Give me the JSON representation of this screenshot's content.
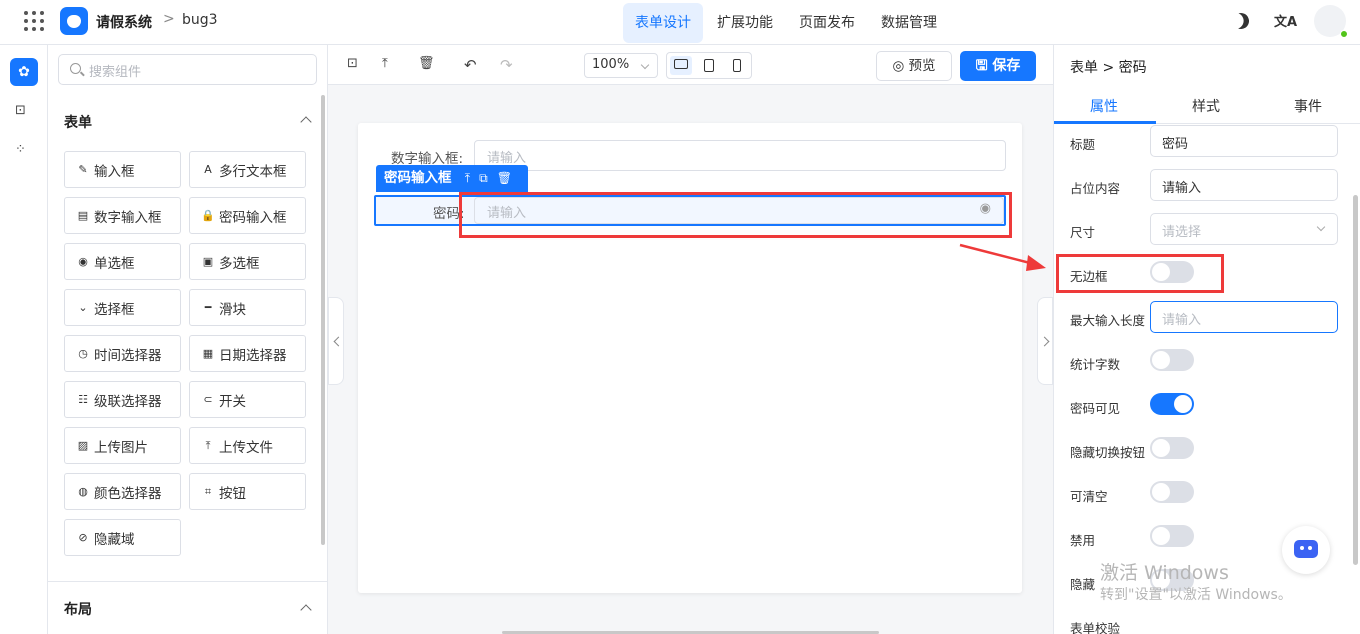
{
  "header": {
    "app_name": "请假系统",
    "separator": ">",
    "project": "bug3",
    "nav": [
      "表单设计",
      "扩展功能",
      "页面发布",
      "数据管理"
    ],
    "active_nav": "表单设计",
    "lang_glyph": "文A"
  },
  "rail": {
    "icons": [
      "puzzle-icon",
      "code-icon",
      "tree-icon"
    ]
  },
  "left": {
    "search_placeholder": "搜索组件",
    "form_section": "表单",
    "components": [
      {
        "label": "输入框",
        "icon": "✎"
      },
      {
        "label": "多行文本框",
        "icon": "A"
      },
      {
        "label": "数字输入框",
        "icon": "▤"
      },
      {
        "label": "密码输入框",
        "icon": "🔒"
      },
      {
        "label": "单选框",
        "icon": "◉"
      },
      {
        "label": "多选框",
        "icon": "▣"
      },
      {
        "label": "选择框",
        "icon": "⌄"
      },
      {
        "label": "滑块",
        "icon": "━"
      },
      {
        "label": "时间选择器",
        "icon": "◷"
      },
      {
        "label": "日期选择器",
        "icon": "▦"
      },
      {
        "label": "级联选择器",
        "icon": "☷"
      },
      {
        "label": "开关",
        "icon": "⊂"
      },
      {
        "label": "上传图片",
        "icon": "▨"
      },
      {
        "label": "上传文件",
        "icon": "⤒"
      },
      {
        "label": "颜色选择器",
        "icon": "◍"
      },
      {
        "label": "按钮",
        "icon": "⌗"
      },
      {
        "label": "隐藏域",
        "icon": "⊘"
      }
    ],
    "layout_section": "布局"
  },
  "toolbar": {
    "zoom": "100%",
    "preview": "预览",
    "save": "保存"
  },
  "canvas": {
    "field1_label": "数字输入框:",
    "field1_placeholder": "请输入",
    "selected_component": "密码输入框",
    "field2_label": "密码:",
    "field2_placeholder": "请输入"
  },
  "right": {
    "breadcrumb": "表单 > 密码",
    "tabs": [
      "属性",
      "样式",
      "事件"
    ],
    "active_tab": "属性",
    "props": {
      "title_label": "标题",
      "title_value": "密码",
      "placeholder_label": "占位内容",
      "placeholder_value": "请输入",
      "size_label": "尺寸",
      "size_placeholder": "请选择",
      "borderless_label": "无边框",
      "maxlen_label": "最大输入长度",
      "maxlen_placeholder": "请输入",
      "count_label": "统计字数",
      "pwd_visible_label": "密码可见",
      "hide_toggle_label": "隐藏切换按钮",
      "clearable_label": "可清空",
      "disabled_label": "禁用",
      "hidden_label": "隐藏",
      "validation_label": "表单校验"
    },
    "switches": {
      "borderless": false,
      "count": false,
      "pwd_visible": true,
      "hide_toggle": false,
      "clearable": false,
      "disabled": false,
      "hidden": false
    }
  },
  "watermark": {
    "line1": "激活 Windows",
    "line2": "转到\"设置\"以激活 Windows。"
  },
  "colors": {
    "primary": "#1677ff",
    "highlight": "#ee3a3a"
  }
}
